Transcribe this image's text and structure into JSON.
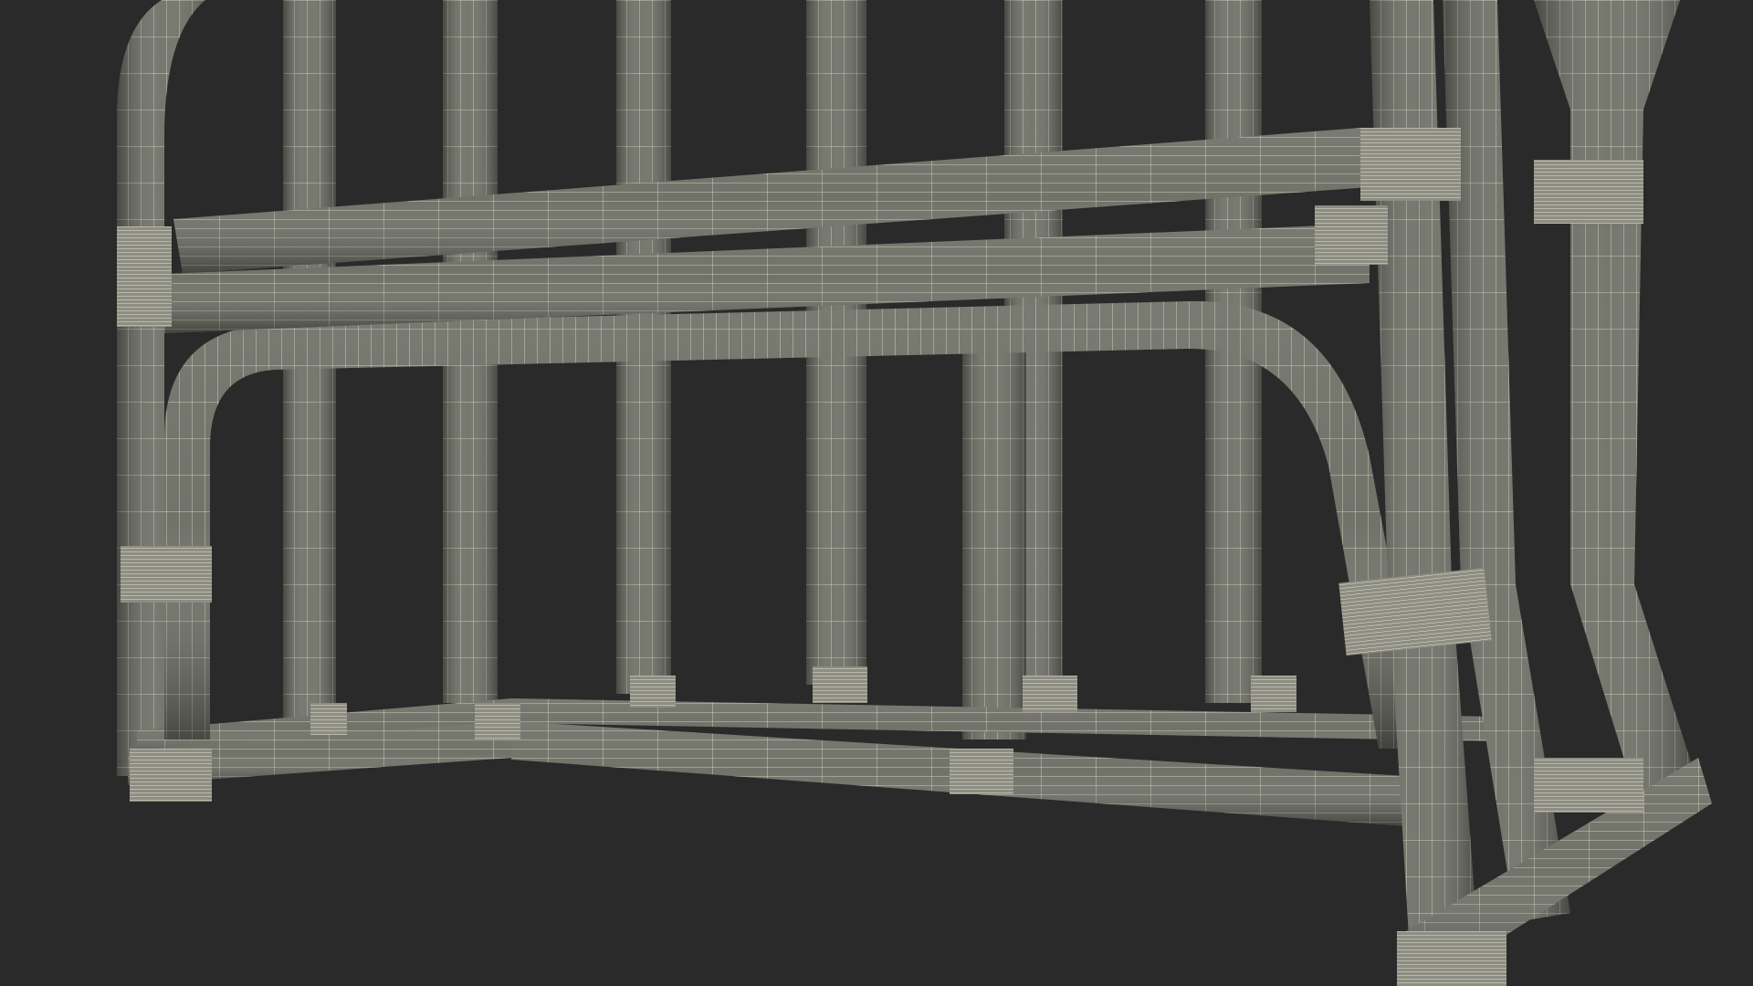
{
  "scene": {
    "subject": "rattan-bench-wireframe-render",
    "colors": {
      "background": "#2a2a2a",
      "tube_fill": "#6e6f66",
      "tube_shade": "#4f5049",
      "tube_highlight": "#8a8b80",
      "wire": "#e8e6cf",
      "binding": "#9a9a8e"
    }
  }
}
